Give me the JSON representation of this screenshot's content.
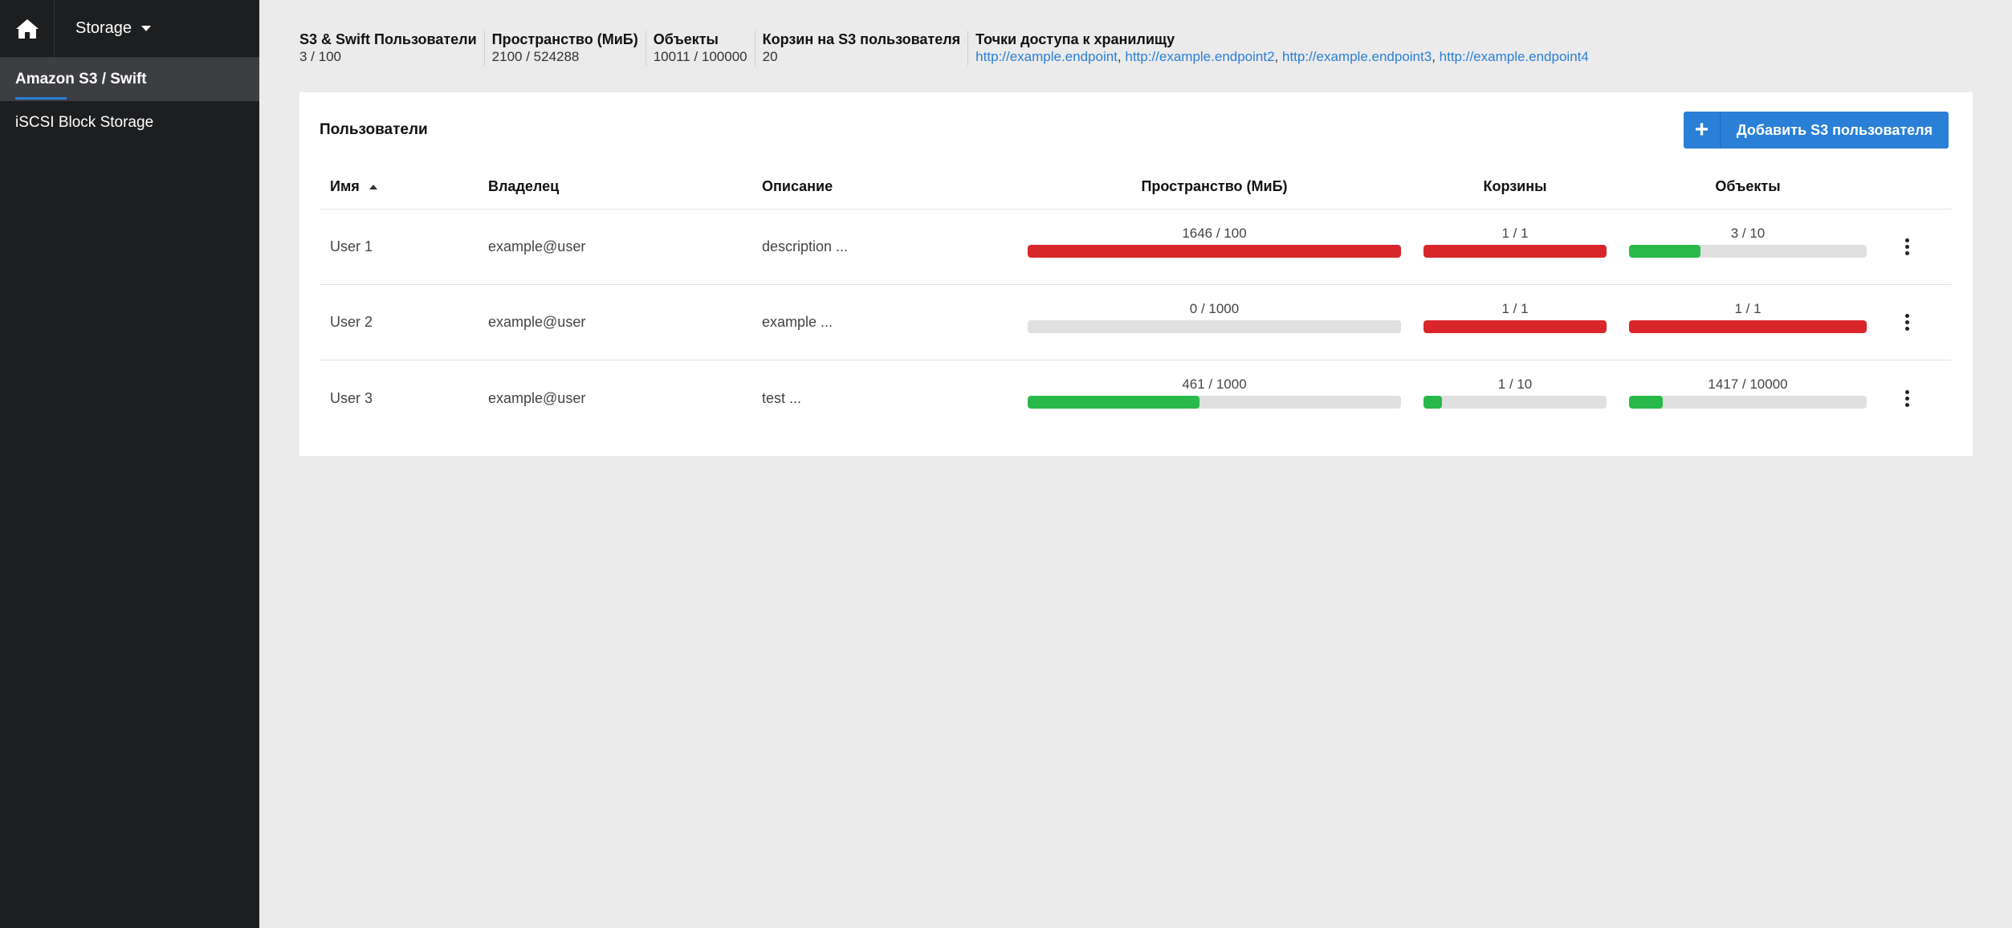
{
  "sidebar": {
    "app_name": "Storage",
    "items": [
      {
        "label": "Amazon S3 / Swift",
        "active": true
      },
      {
        "label": "iSCSI Block Storage",
        "active": false
      }
    ]
  },
  "stats": {
    "users": {
      "label": "S3 & Swift Пользователи",
      "value": "3 / 100"
    },
    "space": {
      "label": "Пространство (МиБ)",
      "value": "2100 / 524288"
    },
    "objects": {
      "label": "Объекты",
      "value": "10011 / 100000"
    },
    "buckets": {
      "label": "Корзин на S3 пользователя",
      "value": "20"
    },
    "endpoints": {
      "label": "Точки доступа к хранилищу",
      "links": [
        "http://example.endpoint",
        "http://example.endpoint2",
        "http://example.endpoint3",
        "http://example.endpoint4"
      ]
    }
  },
  "panel": {
    "title": "Пользователи",
    "add_button_label": "Добавить S3 пользователя"
  },
  "table": {
    "headers": {
      "name": "Имя",
      "owner": "Владелец",
      "description": "Описание",
      "space": "Пространство (МиБ)",
      "buckets": "Корзины",
      "objects": "Объекты"
    },
    "rows": [
      {
        "name": "User 1",
        "owner": "example@user",
        "description": "description  ...",
        "space": {
          "text": "1646 / 100",
          "fraction": 1.0,
          "status": "red"
        },
        "buckets": {
          "text": "1 / 1",
          "fraction": 1.0,
          "status": "red"
        },
        "objects": {
          "text": "3 / 10",
          "fraction": 0.3,
          "status": "green"
        }
      },
      {
        "name": "User 2",
        "owner": "example@user",
        "description": "example  ...",
        "space": {
          "text": "0 / 1000",
          "fraction": 0.0,
          "status": "green"
        },
        "buckets": {
          "text": "1 / 1",
          "fraction": 1.0,
          "status": "red"
        },
        "objects": {
          "text": "1 / 1",
          "fraction": 1.0,
          "status": "red"
        }
      },
      {
        "name": "User 3",
        "owner": "example@user",
        "description": "test  ...",
        "space": {
          "text": "461 / 1000",
          "fraction": 0.461,
          "status": "green"
        },
        "buckets": {
          "text": "1 / 10",
          "fraction": 0.1,
          "status": "green"
        },
        "objects": {
          "text": "1417 / 10000",
          "fraction": 0.1417,
          "status": "green"
        }
      }
    ]
  },
  "icons": {
    "home": "home-icon",
    "plus": "plus-icon",
    "kebab": "kebab-menu-icon",
    "sort": "sort-asc-icon",
    "caret": "caret-down-icon"
  },
  "colors": {
    "accent": "#2a7fd6",
    "danger": "#d9262b",
    "ok": "#28b94a",
    "sidebar": "#1d1e20"
  }
}
